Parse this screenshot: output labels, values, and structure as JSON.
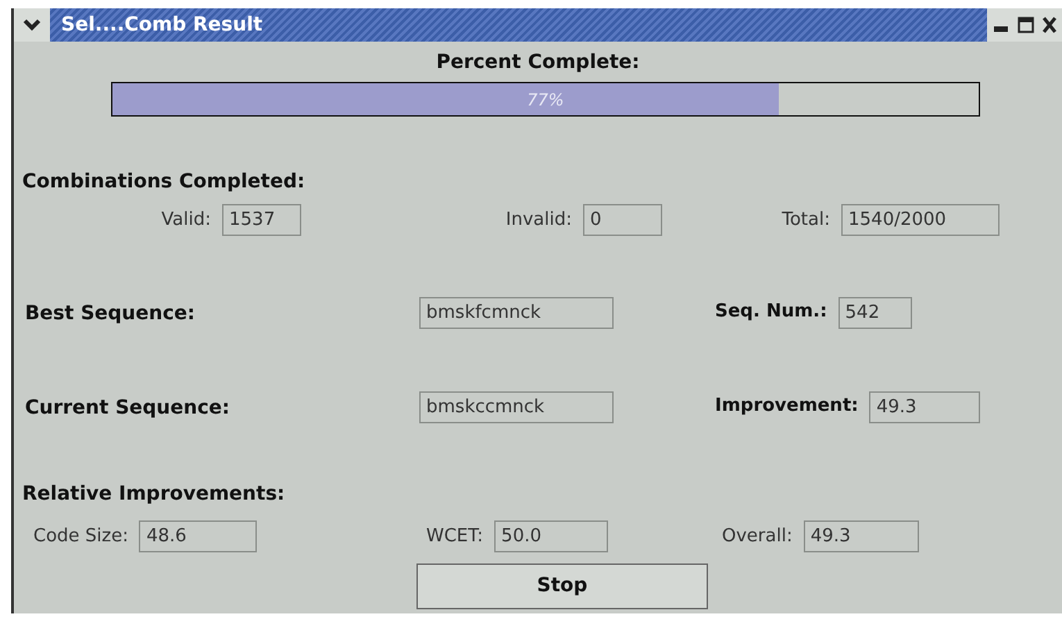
{
  "window": {
    "title": "Sel....Comb Result"
  },
  "progress": {
    "label": "Percent Complete:",
    "level": 0.77,
    "text": "77%"
  },
  "combinations": {
    "heading": "Combinations Completed:",
    "fields": [
      {
        "label": "Valid:",
        "value": "1537"
      },
      {
        "label": "Invalid:",
        "value": "0"
      },
      {
        "label": "Total:",
        "value": "1540/2000"
      }
    ]
  },
  "best": {
    "label": "Best Sequence:",
    "value": "bmskfcmnck",
    "side_label": "Seq. Num.:",
    "side_value": "542"
  },
  "current": {
    "label": "Current Sequence:",
    "value": "bmskccmnck",
    "side_label": "Improvement:",
    "side_value": "49.3"
  },
  "relative": {
    "heading": "Relative Improvements:",
    "fields": [
      {
        "label": "Code Size:",
        "value": "48.6"
      },
      {
        "label": "WCET:",
        "value": "50.0"
      },
      {
        "label": "Overall:",
        "value": "49.3"
      }
    ]
  },
  "button": "Stop"
}
